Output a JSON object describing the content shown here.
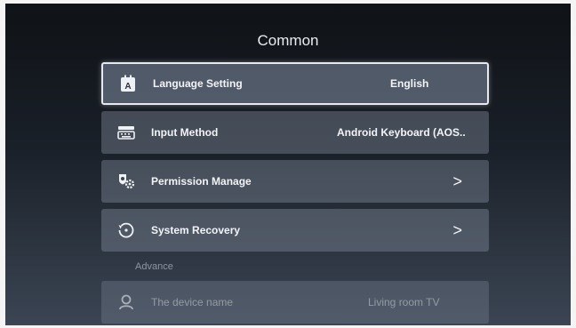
{
  "page": {
    "title": "Common"
  },
  "settings": [
    {
      "label": "Language Setting",
      "value": "English",
      "icon": "language-icon"
    },
    {
      "label": "Input Method",
      "value": "Android Keyboard (AOS..",
      "icon": "keyboard-icon"
    },
    {
      "label": "Permission Manage",
      "value": ">",
      "icon": "permission-icon"
    },
    {
      "label": "System Recovery",
      "value": ">",
      "icon": "recovery-icon"
    }
  ],
  "advance": {
    "heading": "Advance",
    "items": [
      {
        "label": "The device name",
        "value": "Living room TV",
        "icon": "user-icon"
      }
    ]
  }
}
